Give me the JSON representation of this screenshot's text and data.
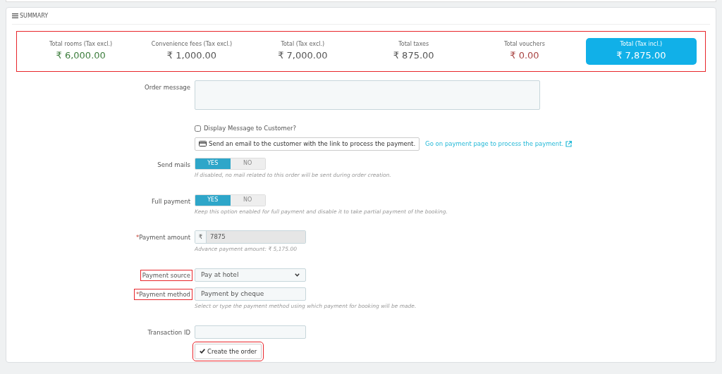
{
  "panel": {
    "title": "SUMMARY"
  },
  "summary": {
    "highlighted": true,
    "items": [
      {
        "label": "Total rooms (Tax excl.)",
        "value": "₹ 6,000.00",
        "color": "#3c7d3c",
        "kind": "plain"
      },
      {
        "label": "Convenience fees (Tax excl.)",
        "value": "₹ 1,000.00",
        "color": "#555555",
        "kind": "plain"
      },
      {
        "label": "Total (Tax excl.)",
        "value": "₹ 7,000.00",
        "color": "#555555",
        "kind": "plain"
      },
      {
        "label": "Total taxes",
        "value": "₹ 875.00",
        "color": "#555555",
        "kind": "plain"
      },
      {
        "label": "Total vouchers",
        "value": "₹ 0.00",
        "color": "#a94442",
        "kind": "plain"
      },
      {
        "label": "Total (Tax incl.)",
        "value": "₹ 7,875.00",
        "color": "#ffffff",
        "kind": "total"
      }
    ]
  },
  "order_message": {
    "label": "Order message"
  },
  "display_message": {
    "label": "Display Message to Customer?",
    "checked": false
  },
  "email_button": {
    "label": "Send an email to the customer with the link to process the payment."
  },
  "payment_link": {
    "label": "Go on payment page to process the payment."
  },
  "send_mails": {
    "label": "Send mails",
    "on": true,
    "yes": "YES",
    "no": "NO",
    "help": "If disabled, no mail related to this order will be sent during order creation."
  },
  "full_payment": {
    "label": "Full payment",
    "on": true,
    "yes": "YES",
    "no": "NO",
    "help": "Keep this option enabled for full payment and disable it to take partial payment of the booking."
  },
  "payment_amount": {
    "label": "Payment amount",
    "required": "*",
    "prefix": "₹",
    "value": "7875",
    "disabled": true,
    "help": "Advance payment amount: ₹ 5,175.00"
  },
  "payment_source": {
    "label": "Payment source",
    "value": "Pay at hotel",
    "highlighted": true
  },
  "payment_method": {
    "label": "Payment method",
    "required": "*",
    "value": "Payment by cheque",
    "highlighted": true,
    "help": "Select or type the payment method using which payment for booking will be made."
  },
  "transaction_id": {
    "label": "Transaction ID"
  },
  "create_button": {
    "label": "Create the order",
    "highlighted": true
  }
}
